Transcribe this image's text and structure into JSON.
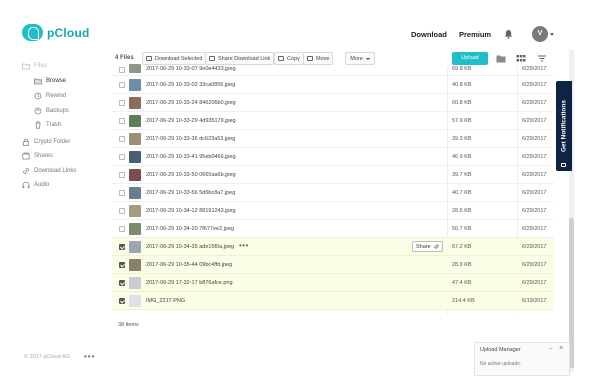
{
  "app": {
    "brand": "pCloud",
    "accent": "#20bec6"
  },
  "header": {
    "download": "Download",
    "premium": "Premium",
    "avatar_initial": "V"
  },
  "sidebar": {
    "items": [
      {
        "label": "Files",
        "icon": "folder-icon"
      },
      {
        "label": "Browse",
        "icon": "folder-open-icon"
      },
      {
        "label": "Rewind",
        "icon": "history-icon"
      },
      {
        "label": "Backups",
        "icon": "backup-icon"
      },
      {
        "label": "Trash",
        "icon": "trash-icon"
      },
      {
        "label": "Crypto Folder",
        "icon": "lock-icon"
      },
      {
        "label": "Shares",
        "icon": "shares-icon"
      },
      {
        "label": "Download Links",
        "icon": "link-icon"
      },
      {
        "label": "Audio",
        "icon": "headphones-icon"
      }
    ],
    "footer": "© 2017 pCloud AG",
    "footer_more": "•••"
  },
  "toolbar": {
    "count": "4 Files",
    "download_selected": "Download Selected",
    "share_download_link": "Share Download Link",
    "copy": "Copy",
    "move": "Move",
    "more": "More",
    "upload": "Upload"
  },
  "files": [
    {
      "name": "2017-06-29 10-33-07 9e0e4433.jpeg",
      "size": "69.8 KB",
      "date": "6/29/2017",
      "selected": false,
      "thumb": "#8b9a86"
    },
    {
      "name": "2017-06-29 10-33-02 33ca0855.jpeg",
      "size": "40.8 KB",
      "date": "6/29/2017",
      "selected": false,
      "thumb": "#6f8fa8"
    },
    {
      "name": "2017-06-29 10-33-24 846206b0.jpeg",
      "size": "60.8 KB",
      "date": "6/29/2017",
      "selected": false,
      "thumb": "#8a6d5a"
    },
    {
      "name": "2017-06-29 10-33-29 4d935179.jpeg",
      "size": "57.9 KB",
      "date": "6/29/2017",
      "selected": false,
      "thumb": "#5e7b5a"
    },
    {
      "name": "2017-06-29 10-33-36 dc623a53.jpeg",
      "size": "39.3 KB",
      "date": "6/29/2017",
      "selected": false,
      "thumb": "#9c8f74"
    },
    {
      "name": "2017-06-29 10-33-41 95eb0466.jpeg",
      "size": "46.9 KB",
      "date": "6/29/2017",
      "selected": false,
      "thumb": "#4a5d73"
    },
    {
      "name": "2017-06-29 10-33-50 0665aa6b.jpeg",
      "size": "39.7 KB",
      "date": "6/29/2017",
      "selected": false,
      "thumb": "#7a4d55"
    },
    {
      "name": "2017-06-29 10-33-56 5d6bc8a7.jpeg",
      "size": "40.7 KB",
      "date": "6/29/2017",
      "selected": false,
      "thumb": "#6b7d8e"
    },
    {
      "name": "2017-06-29 10-34-12 88191243.jpeg",
      "size": "28.6 KB",
      "date": "6/29/2017",
      "selected": false,
      "thumb": "#a89a82"
    },
    {
      "name": "2017-06-29 10-34-20 7f677ee2.jpeg",
      "size": "56.7 KB",
      "date": "6/29/2017",
      "selected": false,
      "thumb": "#7c8a6e"
    },
    {
      "name": "2017-06-29 10-34-35 ade15f0a.jpeg",
      "size": "57.2 KB",
      "date": "6/29/2017",
      "selected": true,
      "thumb": "#9aa7b3"
    },
    {
      "name": "2017-06-29 10-35-44 09bc4ffd.jpeg",
      "size": "28.9 KB",
      "date": "6/29/2017",
      "selected": true,
      "thumb": "#8d7e6c"
    },
    {
      "name": "2017-06-29 17-32-17 b876afce.png",
      "size": "47.4 KB",
      "date": "6/29/2017",
      "selected": true,
      "thumb": "#c9ccd0"
    },
    {
      "name": "IMG_2217.PNG",
      "size": "214.4 KB",
      "date": "6/19/2017",
      "selected": true,
      "thumb": "#dfe2e5"
    }
  ],
  "row_more": "•••",
  "share_label": "Share",
  "items_count": "38 items",
  "notifications_tab": "Get Notifications",
  "upload_manager": {
    "title": "Upload Manager",
    "status": "No active uploads.",
    "minimize": "–",
    "close": "×"
  }
}
